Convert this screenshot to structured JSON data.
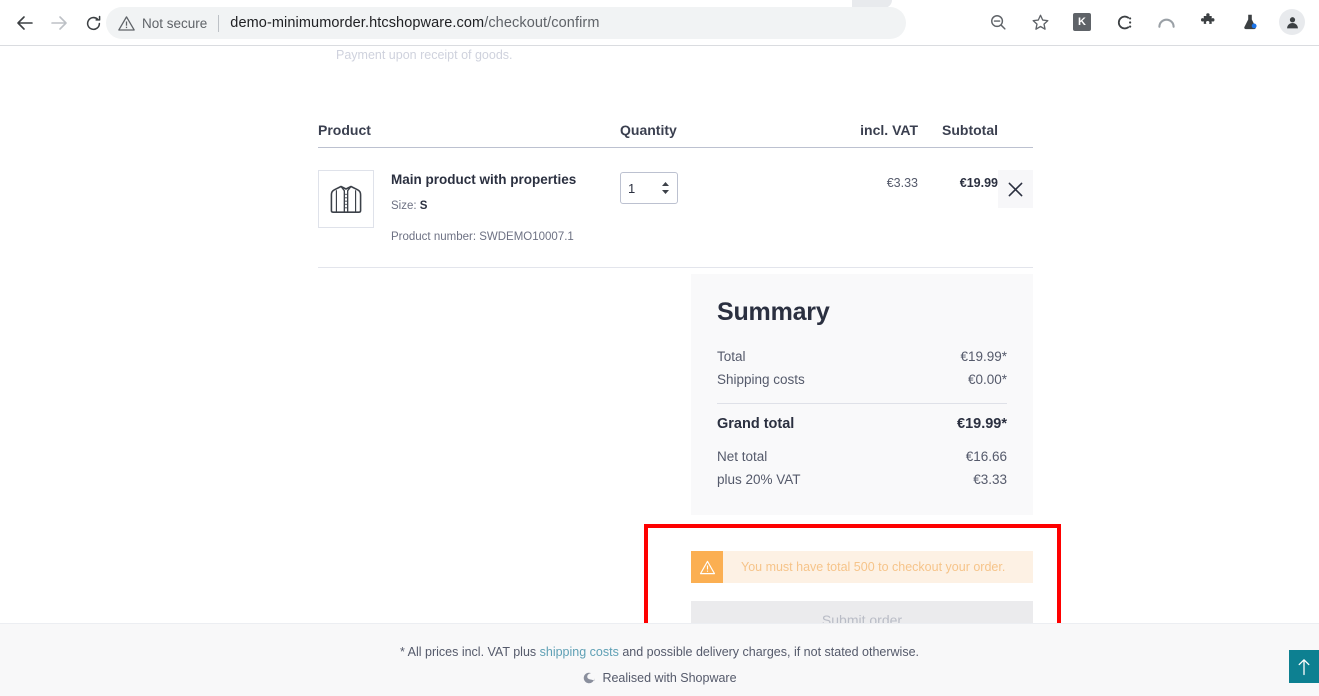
{
  "browser": {
    "back_label": "back-arrow",
    "forward_label": "forward-arrow",
    "reload_label": "reload",
    "security_label": "Not secure",
    "url_host": "demo-minimumorder.htcshopware.com",
    "url_path": "/checkout/confirm",
    "extensions": [
      {
        "name": "extension-k",
        "glyph": "K"
      },
      {
        "name": "extension-c",
        "glyph": "C"
      },
      {
        "name": "extension-arc",
        "glyph": ""
      },
      {
        "name": "extension-puzzle",
        "glyph": ""
      },
      {
        "name": "extension-flask",
        "glyph": ""
      }
    ]
  },
  "page": {
    "payment_note": "Payment upon receipt of goods."
  },
  "cart": {
    "columns": {
      "product": "Product",
      "quantity": "Quantity",
      "vat": "incl. VAT",
      "subtotal": "Subtotal"
    },
    "items": [
      {
        "name": "Main product with properties",
        "variant_label": "Size:",
        "variant_value": "S",
        "product_number_label": "Product number:",
        "product_number": "SWDEMO10007.1",
        "quantity": "1",
        "vat": "€3.33",
        "subtotal": "€19.99",
        "thumb_icon": "jacket-icon",
        "remove_label": "✕"
      }
    ]
  },
  "summary": {
    "title": "Summary",
    "rows": [
      {
        "label": "Total",
        "value": "€19.99*"
      },
      {
        "label": "Shipping costs",
        "value": "€0.00*"
      }
    ],
    "grand_total_label": "Grand total",
    "grand_total_value": "€19.99*",
    "net_rows": [
      {
        "label": "Net total",
        "value": "€16.66"
      },
      {
        "label": "plus 20% VAT",
        "value": "€3.33"
      }
    ]
  },
  "checkout": {
    "alert_text": "You must have total 500 to checkout your order.",
    "alert_icon": "warning-triangle-icon",
    "submit_label": "Submit order"
  },
  "footer": {
    "note_prefix": "* All prices incl. VAT plus ",
    "note_link": "shipping costs",
    "note_suffix": " and possible delivery charges, if not stated otherwise.",
    "brand_text": "Realised with Shopware",
    "brand_icon": "shopware-logo-icon"
  },
  "scroll_top": {
    "label": "scroll-to-top"
  },
  "colors": {
    "accent_teal": "#0d8091",
    "warning_orange": "#fbaf52",
    "warning_bg": "#fdf1e4",
    "highlight_red": "#fe0000",
    "link_blue": "#5fa0b5"
  }
}
